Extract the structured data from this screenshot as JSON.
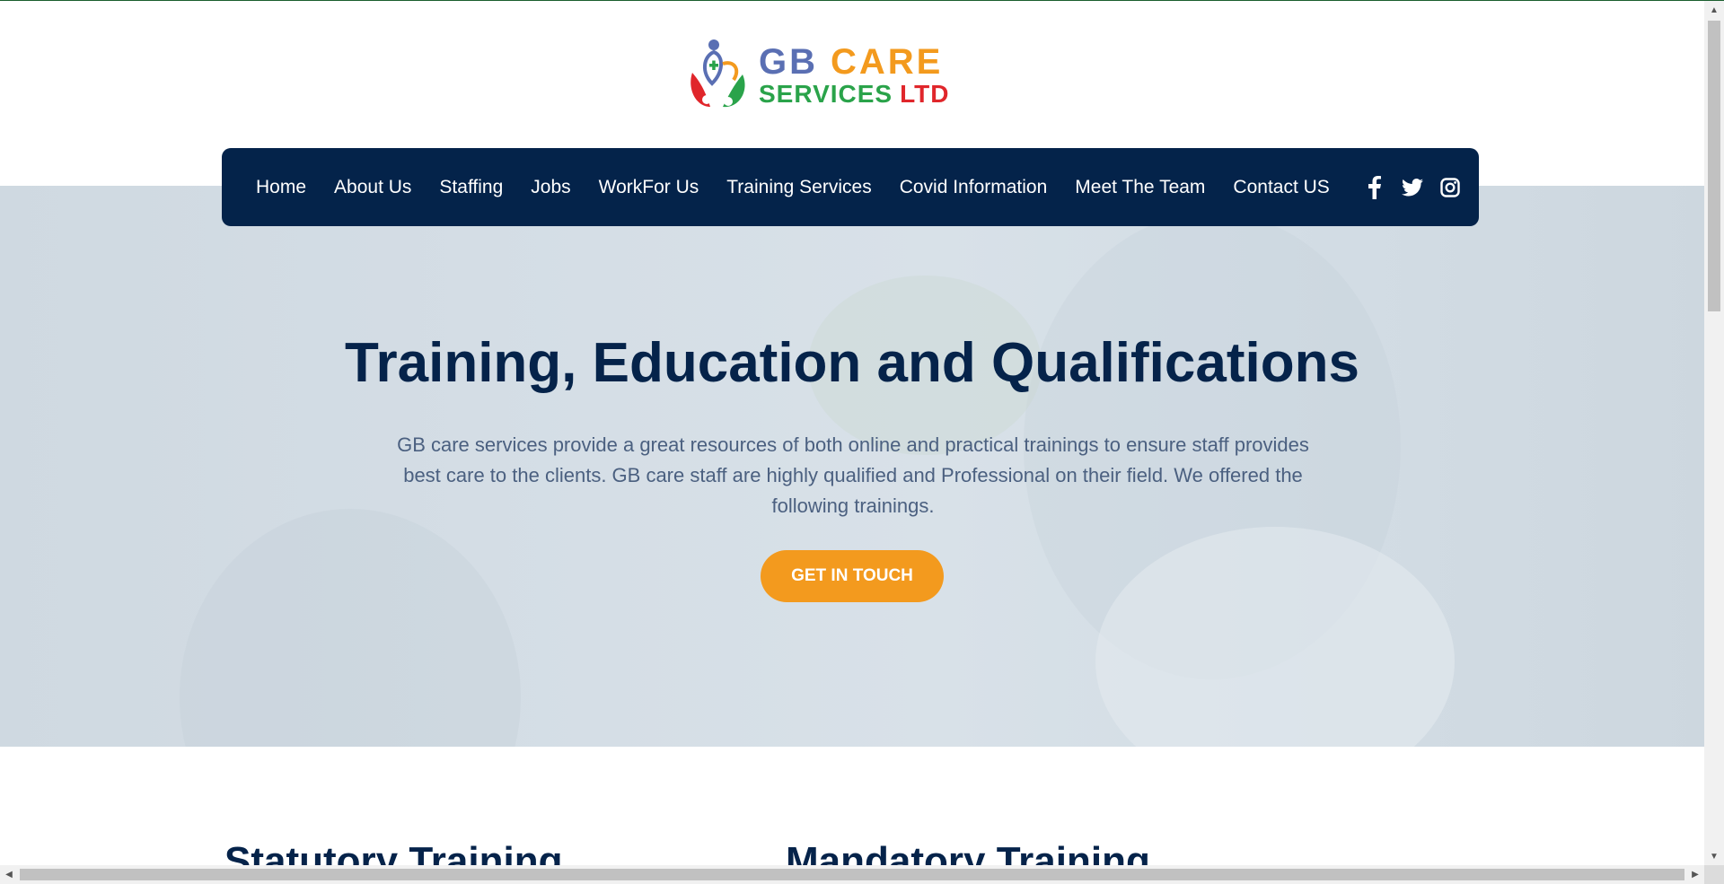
{
  "brand": {
    "logo_line1_a": "GB",
    "logo_line1_b": "CARE",
    "logo_line2_a": "SERVICES",
    "logo_line2_b": "LTD",
    "colors": {
      "blue": "#5a6fb3",
      "orange": "#f39a1e",
      "green": "#2aa34a",
      "red": "#e0262b"
    }
  },
  "nav": {
    "items": [
      {
        "label": "Home"
      },
      {
        "label": "About Us"
      },
      {
        "label": "Staffing"
      },
      {
        "label": "Jobs"
      },
      {
        "label": "WorkFor Us"
      },
      {
        "label": "Training Services"
      },
      {
        "label": "Covid Information"
      },
      {
        "label": "Meet The Team"
      },
      {
        "label": "Contact US"
      }
    ],
    "social": [
      "facebook-icon",
      "twitter-icon",
      "instagram-icon"
    ],
    "background": "#04234a"
  },
  "hero": {
    "title": "Training, Education and Qualifications",
    "text": "GB care services provide a great resources of both online and practical trainings to ensure staff provides best care to the clients. GB care staff are highly qualified and Professional on their field. We offered the following trainings.",
    "cta_label": "GET IN TOUCH",
    "cta_color": "#f39a1e"
  },
  "sections": {
    "statutory_title": "Statutory Training",
    "mandatory_title": "Mandatory Training"
  }
}
